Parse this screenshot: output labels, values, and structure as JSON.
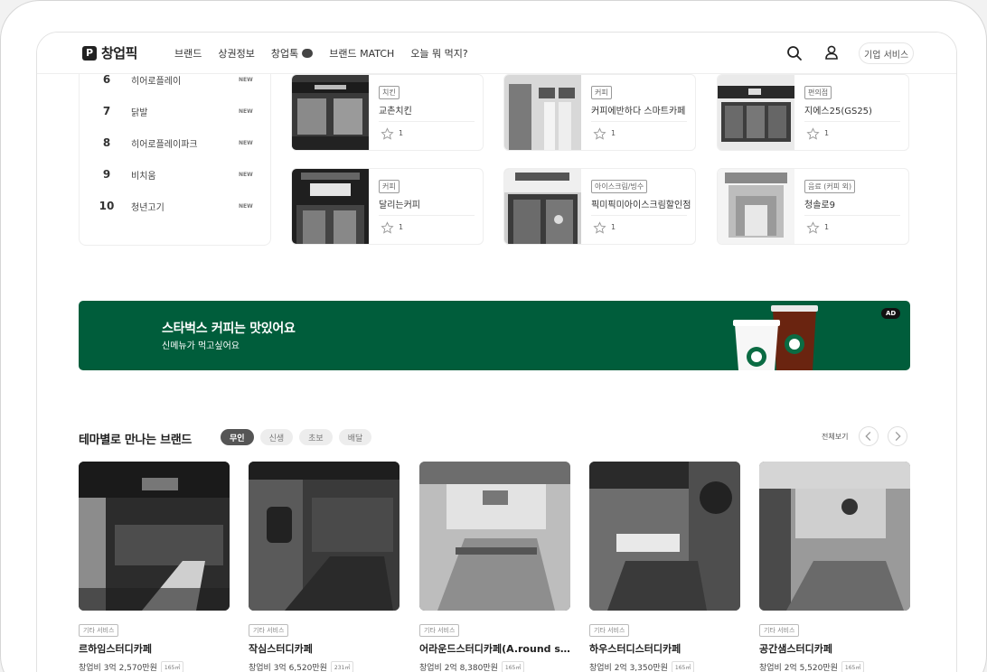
{
  "header": {
    "logo_text": "창업픽",
    "logo_mark": "P",
    "nav": [
      "브랜드",
      "상권정보",
      "창업톡",
      "브랜드 MATCH",
      "오늘 뭐 먹지?"
    ],
    "corp_button": "기업 서비스"
  },
  "ranking": [
    {
      "rank": "6",
      "name": "히어로플레이",
      "badge": "NEW"
    },
    {
      "rank": "7",
      "name": "닭발",
      "badge": "NEW"
    },
    {
      "rank": "8",
      "name": "히어로플레이파크",
      "badge": "NEW"
    },
    {
      "rank": "9",
      "name": "비치움",
      "badge": "NEW"
    },
    {
      "rank": "10",
      "name": "청년고기",
      "badge": "NEW"
    }
  ],
  "brand_cards": [
    {
      "tag": "치킨",
      "name": "교촌치킨",
      "likes": "1"
    },
    {
      "tag": "커피",
      "name": "커피에반하다 스마트카페",
      "likes": "1"
    },
    {
      "tag": "편의점",
      "name": "지에스25(GS25)",
      "likes": "1"
    },
    {
      "tag": "커피",
      "name": "달리는커피",
      "likes": "1"
    },
    {
      "tag": "아이스크림/빙수",
      "name": "픽미픽미아이스크림할인점",
      "likes": "1"
    },
    {
      "tag": "음료 (커피 외)",
      "name": "청솔로9",
      "likes": "1"
    }
  ],
  "ad": {
    "title": "스타벅스 커피는 맛있어요",
    "subtitle": "신메뉴가 먹고싶어요",
    "badge": "AD",
    "background": "#005d3b"
  },
  "theme": {
    "title": "테마별로 만나는 브랜드",
    "chips": [
      "무인",
      "신생",
      "초보",
      "배달"
    ],
    "active_chip": "무인",
    "view_all": "전체보기",
    "cards": [
      {
        "tag": "기타 서비스",
        "name": "르하임스터디카페",
        "cost": "창업비 3억 2,570만원",
        "area": "165㎡"
      },
      {
        "tag": "기타 서비스",
        "name": "작심스터디카페",
        "cost": "창업비 3억 6,520만원",
        "area": "231㎡"
      },
      {
        "tag": "기타 서비스",
        "name": "어라운드스터디카페(A.round s...",
        "cost": "창업비 2억 8,380만원",
        "area": "165㎡"
      },
      {
        "tag": "기타 서비스",
        "name": "하우스터디스터디카페",
        "cost": "창업비 2억 3,350만원",
        "area": "165㎡"
      },
      {
        "tag": "기타 서비스",
        "name": "공간샘스터디카페",
        "cost": "창업비 2억 5,520만원",
        "area": "165㎡"
      }
    ]
  }
}
